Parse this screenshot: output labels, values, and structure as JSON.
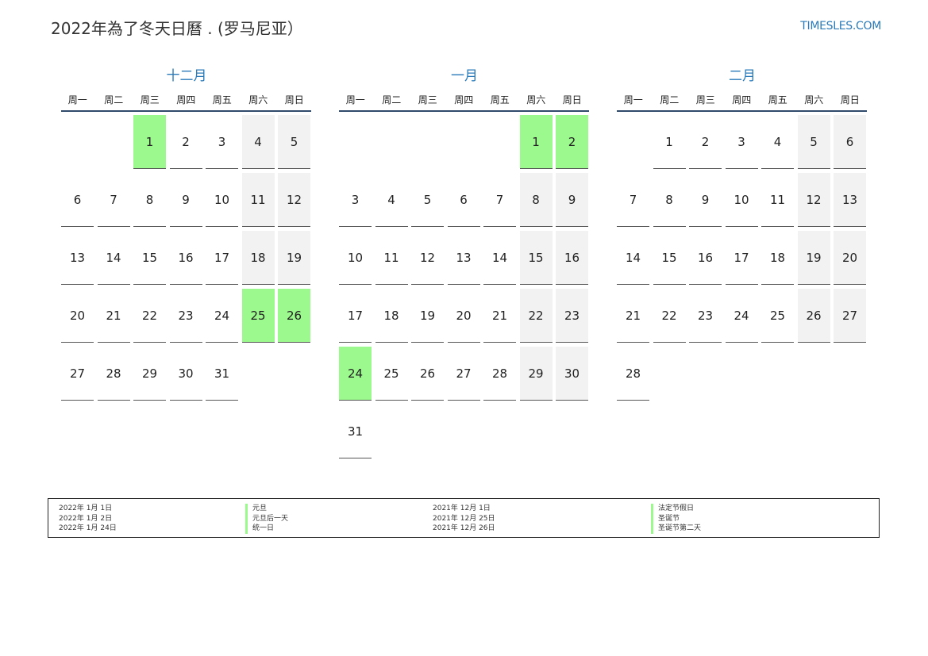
{
  "title": "2022年為了冬天日曆 . (罗马尼亚）",
  "site": "TIMESLES.COM",
  "weekdays": [
    "周一",
    "周二",
    "周三",
    "周四",
    "周五",
    "周六",
    "周日"
  ],
  "colors": {
    "accent": "#2a7ab9",
    "holiday": "#9bf98d",
    "weekend": "#f2f2f2",
    "rule": "#2f4a6b"
  },
  "months": [
    {
      "name": "十二月",
      "startOffset": 2,
      "days": 31,
      "holidays": [
        1,
        25,
        26
      ]
    },
    {
      "name": "一月",
      "startOffset": 5,
      "days": 31,
      "holidays": [
        1,
        2,
        24
      ]
    },
    {
      "name": "二月",
      "startOffset": 1,
      "days": 28,
      "holidays": []
    }
  ],
  "legend": {
    "col1_dates": [
      "2022年 1月 1日",
      "2022年 1月 2日",
      "2022年 1月 24日"
    ],
    "col1_names": [
      "元旦",
      "元旦后一天",
      "统一日"
    ],
    "col2_dates": [
      "2021年 12月 1日",
      "2021年 12月 25日",
      "2021年 12月 26日"
    ],
    "col2_names": [
      "法定节假日",
      "圣诞节",
      "圣诞节第二天"
    ]
  }
}
